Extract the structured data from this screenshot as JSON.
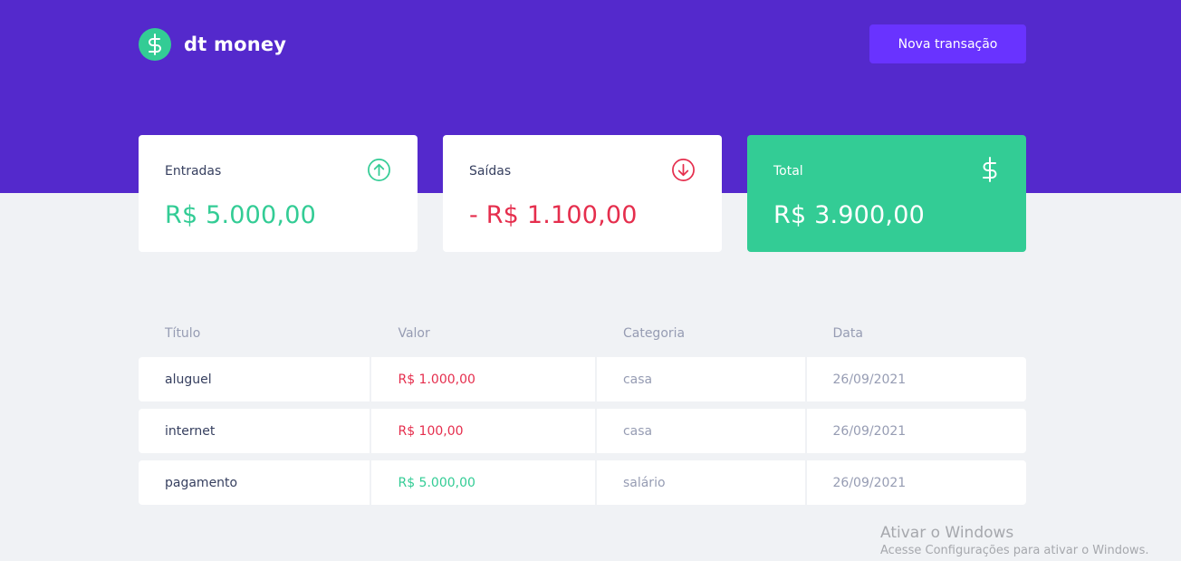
{
  "header": {
    "logo_text": "dt money",
    "logo_icon": "dollar-icon",
    "new_transaction_label": "Nova transação"
  },
  "summary": {
    "income": {
      "label": "Entradas",
      "amount": "R$ 5.000,00",
      "icon": "arrow-up-circle-icon",
      "color": "#33cc95"
    },
    "outcome": {
      "label": "Saídas",
      "amount": "- R$ 1.100,00",
      "icon": "arrow-down-circle-icon",
      "color": "#e52e4d"
    },
    "total": {
      "label": "Total",
      "amount": "R$ 3.900,00",
      "icon": "dollar-icon",
      "color": "#33cc95"
    }
  },
  "table": {
    "columns": [
      "Título",
      "Valor",
      "Categoria",
      "Data"
    ],
    "rows": [
      {
        "title": "aluguel",
        "value": "R$ 1.000,00",
        "type": "outcome",
        "category": "casa",
        "date": "26/09/2021"
      },
      {
        "title": "internet",
        "value": "R$ 100,00",
        "type": "outcome",
        "category": "casa",
        "date": "26/09/2021"
      },
      {
        "title": "pagamento",
        "value": "R$ 5.000,00",
        "type": "income",
        "category": "salário",
        "date": "26/09/2021"
      }
    ]
  },
  "watermark": {
    "title": "Ativar o Windows",
    "subtitle": "Acesse Configurações para ativar o Windows."
  },
  "colors": {
    "brand_purple": "#5429cc",
    "button_purple": "#6933ff",
    "green": "#33cc95",
    "red": "#e52e4d",
    "background": "#f0f2f5"
  }
}
